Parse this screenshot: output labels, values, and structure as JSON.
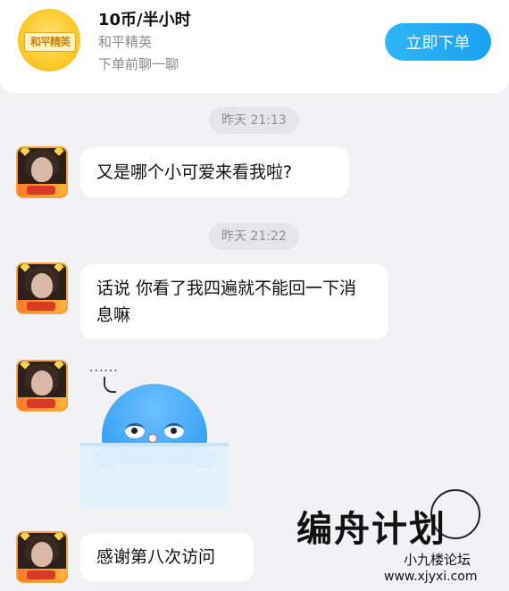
{
  "order": {
    "price": "10币/半小时",
    "game": "和平精英",
    "note": "下单前聊一聊",
    "button": "立即下单",
    "logo_text": "和平精英",
    "accent": "#1aa0f0"
  },
  "messages": [
    {
      "time": "昨天 21:13",
      "text": "又是哪个小可爱来看我啦?"
    },
    {
      "time": "昨天 21:22",
      "text": "话说 你看了我四遍就不能回一下消息嘛"
    },
    {
      "sticker": "sleepy-whale-sticker",
      "sticker_text": "......"
    },
    {
      "text": "感谢第八次访问"
    }
  ],
  "watermark": {
    "title": "编舟计划",
    "sub": "小九楼论坛",
    "url": "www.xjyxi.com"
  }
}
